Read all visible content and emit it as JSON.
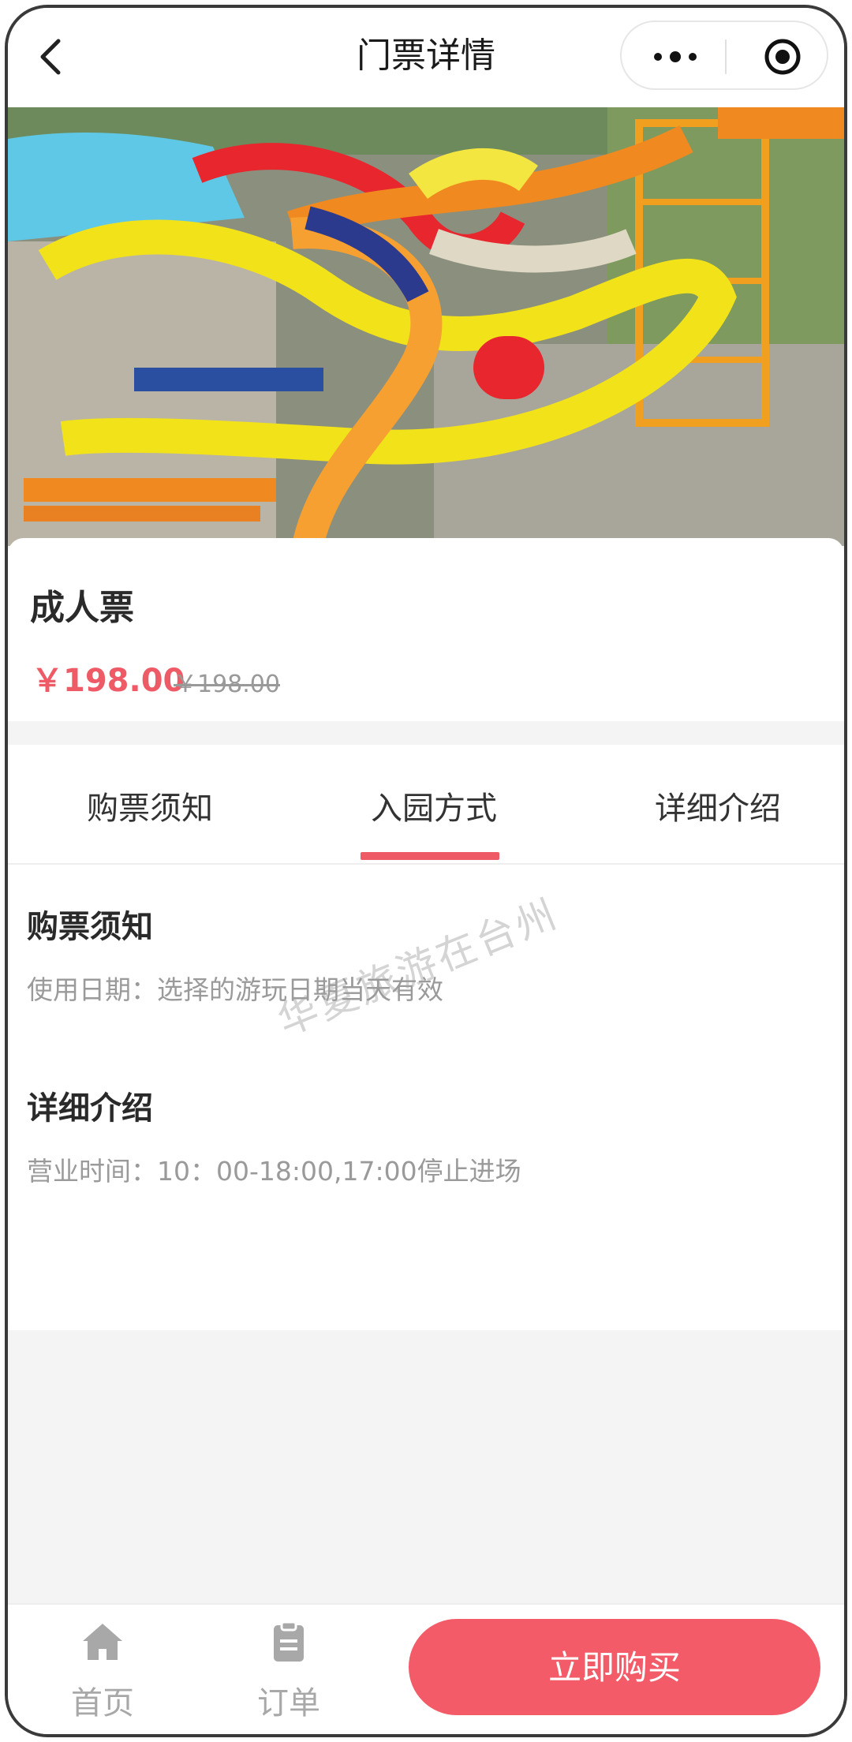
{
  "nav": {
    "title": "门票详情",
    "back_icon": "chevron-left-icon",
    "more_icon": "more-dots-icon",
    "target_icon": "target-icon"
  },
  "hero": {
    "icon": "water-park-photo"
  },
  "ticket": {
    "name": "成人票",
    "price": "￥198.00",
    "original_price": "￥198.00"
  },
  "tabs": [
    {
      "label": "购票须知"
    },
    {
      "label": "入园方式",
      "active": true
    },
    {
      "label": "详细介绍"
    }
  ],
  "sections": [
    {
      "title": "购票须知",
      "text": "使用日期：选择的游玩日期当天有效"
    },
    {
      "title": "详细介绍",
      "text": "营业时间：10：00-18:00,17:00停止进场"
    }
  ],
  "watermark": "华夏旅游在台州",
  "bottom_nav": [
    {
      "label": "首页",
      "icon": "home-icon"
    },
    {
      "label": "订单",
      "icon": "clipboard-icon"
    }
  ],
  "buy_button": "立即购买",
  "colors": {
    "accent": "#f25b67",
    "price": "#ee5b66"
  }
}
